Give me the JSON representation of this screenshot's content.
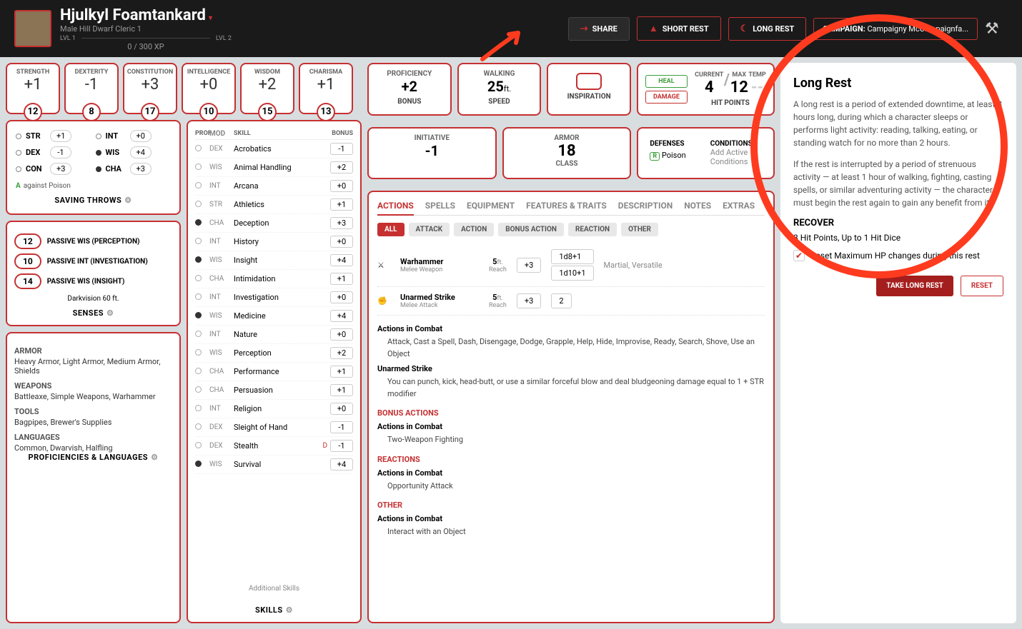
{
  "header": {
    "name": "Hjulkyl Foamtankard",
    "meta": "Male  Hill Dwarf  Cleric 1",
    "lvl_left": "LVL 1",
    "lvl_xp": "0 / 300 XP",
    "lvl_right": "LVL 2",
    "share": "SHARE",
    "short_rest": "SHORT REST",
    "long_rest": "LONG REST",
    "campaign_label": "CAMPAIGN:",
    "campaign_name": "Campaigny McCampaignfa..."
  },
  "abilities": [
    {
      "label": "STRENGTH",
      "mod": "+1",
      "score": "12"
    },
    {
      "label": "DEXTERITY",
      "mod": "-1",
      "score": "8"
    },
    {
      "label": "CONSTITUTION",
      "mod": "+3",
      "score": "17"
    },
    {
      "label": "INTELLIGENCE",
      "mod": "+0",
      "score": "10"
    },
    {
      "label": "WISDOM",
      "mod": "+2",
      "score": "15"
    },
    {
      "label": "CHARISMA",
      "mod": "+1",
      "score": "13"
    }
  ],
  "top_stats": {
    "prof_label_top": "PROFICIENCY",
    "prof_val": "+2",
    "prof_label": "BONUS",
    "speed_label_top": "WALKING",
    "speed_val": "25",
    "speed_unit": "ft.",
    "speed_label": "SPEED",
    "insp_label": "INSPIRATION"
  },
  "hp": {
    "heal": "HEAL",
    "damage": "DAMAGE",
    "current_label": "CURRENT",
    "current": "4",
    "max_label": "MAX",
    "max": "12",
    "temp_label": "TEMP",
    "hp_label": "HIT POINTS"
  },
  "mid": {
    "init_label": "INITIATIVE",
    "init": "-1",
    "ac_label_top": "ARMOR",
    "ac": "18",
    "ac_label": "CLASS",
    "def_title": "DEFENSES",
    "def_item": "Poison",
    "cond_title": "CONDITIONS",
    "cond_add": "Add Active Conditions"
  },
  "saves": {
    "items": [
      {
        "name": "STR",
        "val": "+1",
        "prof": false
      },
      {
        "name": "INT",
        "val": "+0",
        "prof": false
      },
      {
        "name": "DEX",
        "val": "-1",
        "prof": false
      },
      {
        "name": "WIS",
        "val": "+4",
        "prof": true
      },
      {
        "name": "CON",
        "val": "+3",
        "prof": false
      },
      {
        "name": "CHA",
        "val": "+3",
        "prof": true
      }
    ],
    "advantage": "against Poison",
    "title": "SAVING THROWS"
  },
  "senses": {
    "items": [
      {
        "val": "12",
        "label": "PASSIVE WIS (PERCEPTION)"
      },
      {
        "val": "10",
        "label": "PASSIVE INT (INVESTIGATION)"
      },
      {
        "val": "14",
        "label": "PASSIVE WIS (INSIGHT)"
      }
    ],
    "extra": "Darkvision 60 ft.",
    "title": "SENSES"
  },
  "profs": {
    "armor_h": "ARMOR",
    "armor": "Heavy Armor, Light Armor, Medium Armor, Shields",
    "weapons_h": "WEAPONS",
    "weapons": "Battleaxe, Simple Weapons, Warhammer",
    "tools_h": "TOOLS",
    "tools": "Bagpipes, Brewer's Supplies",
    "langs_h": "LANGUAGES",
    "langs": "Common, Dwarvish, Halfling",
    "title": "PROFICIENCIES & LANGUAGES"
  },
  "skills": {
    "hdr_prof": "PROF",
    "hdr_mod": "MOD",
    "hdr_skill": "SKILL",
    "hdr_bonus": "BONUS",
    "items": [
      {
        "prof": false,
        "mod": "DEX",
        "name": "Acrobatics",
        "bonus": "-1",
        "dis": false
      },
      {
        "prof": false,
        "mod": "WIS",
        "name": "Animal Handling",
        "bonus": "+2",
        "dis": false
      },
      {
        "prof": false,
        "mod": "INT",
        "name": "Arcana",
        "bonus": "+0",
        "dis": false
      },
      {
        "prof": false,
        "mod": "STR",
        "name": "Athletics",
        "bonus": "+1",
        "dis": false
      },
      {
        "prof": true,
        "mod": "CHA",
        "name": "Deception",
        "bonus": "+3",
        "dis": false
      },
      {
        "prof": false,
        "mod": "INT",
        "name": "History",
        "bonus": "+0",
        "dis": false
      },
      {
        "prof": true,
        "mod": "WIS",
        "name": "Insight",
        "bonus": "+4",
        "dis": false
      },
      {
        "prof": false,
        "mod": "CHA",
        "name": "Intimidation",
        "bonus": "+1",
        "dis": false
      },
      {
        "prof": false,
        "mod": "INT",
        "name": "Investigation",
        "bonus": "+0",
        "dis": false
      },
      {
        "prof": true,
        "mod": "WIS",
        "name": "Medicine",
        "bonus": "+4",
        "dis": false
      },
      {
        "prof": false,
        "mod": "INT",
        "name": "Nature",
        "bonus": "+0",
        "dis": false
      },
      {
        "prof": false,
        "mod": "WIS",
        "name": "Perception",
        "bonus": "+2",
        "dis": false
      },
      {
        "prof": false,
        "mod": "CHA",
        "name": "Performance",
        "bonus": "+1",
        "dis": false
      },
      {
        "prof": false,
        "mod": "CHA",
        "name": "Persuasion",
        "bonus": "+1",
        "dis": false
      },
      {
        "prof": false,
        "mod": "INT",
        "name": "Religion",
        "bonus": "+0",
        "dis": false
      },
      {
        "prof": false,
        "mod": "DEX",
        "name": "Sleight of Hand",
        "bonus": "-1",
        "dis": false
      },
      {
        "prof": false,
        "mod": "DEX",
        "name": "Stealth",
        "bonus": "-1",
        "dis": true
      },
      {
        "prof": true,
        "mod": "WIS",
        "name": "Survival",
        "bonus": "+4",
        "dis": false
      }
    ],
    "additional": "Additional Skills",
    "title": "SKILLS"
  },
  "tabs": [
    "ACTIONS",
    "SPELLS",
    "EQUIPMENT",
    "FEATURES & TRAITS",
    "DESCRIPTION",
    "NOTES",
    "EXTRAS"
  ],
  "filters": [
    "ALL",
    "ATTACK",
    "ACTION",
    "BONUS ACTION",
    "REACTION",
    "OTHER"
  ],
  "actions": {
    "warhammer": {
      "name": "Warhammer",
      "sub": "Melee Weapon",
      "range_v": "5",
      "range_u": "ft.",
      "range_l": "Reach",
      "hit": "+3",
      "dmg1": "1d8+1",
      "dmg2": "1d10+1",
      "tags": "Martial, Versatile"
    },
    "unarmed": {
      "name": "Unarmed Strike",
      "sub": "Melee Attack",
      "range_v": "5",
      "range_u": "ft.",
      "range_l": "Reach",
      "hit": "+3",
      "dmg": "2"
    },
    "combat_h": "Actions in Combat",
    "combat_list": "Attack, Cast a Spell, Dash, Disengage, Dodge, Grapple, Help, Hide, Improvise, Ready, Search, Shove, Use an Object",
    "unarmed_h": "Unarmed Strike",
    "unarmed_desc": "You can punch, kick, head-butt, or use a similar forceful blow and deal bludgeoning damage equal to 1 + STR modifier",
    "bonus_h": "BONUS ACTIONS",
    "bonus_combat": "Two-Weapon Fighting",
    "react_h": "REACTIONS",
    "react_combat": "Opportunity Attack",
    "other_h": "OTHER",
    "other_combat": "Interact with an Object"
  },
  "panel": {
    "title": "Long Rest",
    "p1": "A long rest is a period of extended downtime, at least 8 hours long, during which a character sleeps or performs light activity: reading, talking, eating, or standing watch for no more than 2 hours.",
    "p2": "If the rest is interrupted by a period of strenuous activity — at least 1 hour of walking, fighting, casting spells, or similar adventuring activity — the characters must begin the rest again to gain any benefit from it.",
    "recover_h": "RECOVER",
    "recover_text": "8 Hit Points, Up to 1 Hit Dice",
    "chk_label": "Reset Maximum HP changes during this rest",
    "btn_primary": "TAKE LONG REST",
    "btn_reset": "RESET"
  }
}
